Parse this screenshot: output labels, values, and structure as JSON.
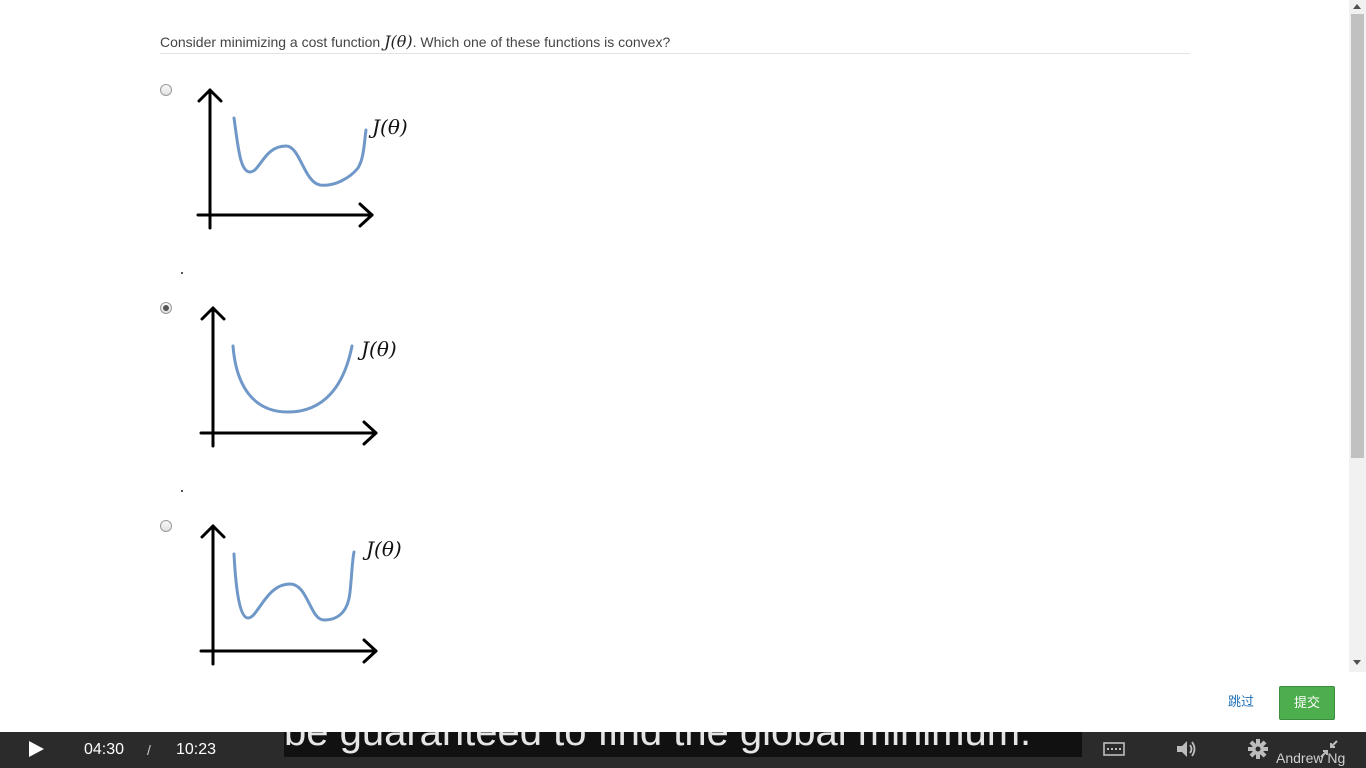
{
  "question": {
    "prefix": "Consider minimizing a cost function",
    "math": "J(θ)",
    "suffix": ". Which one of these functions is convex?"
  },
  "options": [
    {
      "label": "J(θ)",
      "selected": false
    },
    {
      "label": "J(θ)",
      "selected": true
    },
    {
      "label": "J(θ)",
      "selected": false
    }
  ],
  "actions": {
    "skip_label": "跳过",
    "submit_label": "提交"
  },
  "player": {
    "current_time": "04:30",
    "separator": "/",
    "total_time": "10:23",
    "subtitle": "be guaranteed to find the global minimum.",
    "watermark": "Andrew Ng"
  },
  "colors": {
    "curve": "#6f98c8",
    "submit": "#4cae4c",
    "link": "#1f6fb5",
    "player_bg": "#2b2b2b"
  },
  "icons": {
    "play": "play-icon",
    "captions": "captions-icon",
    "volume": "volume-icon",
    "settings": "gear-icon",
    "exit_fullscreen": "exit-fullscreen-icon"
  }
}
